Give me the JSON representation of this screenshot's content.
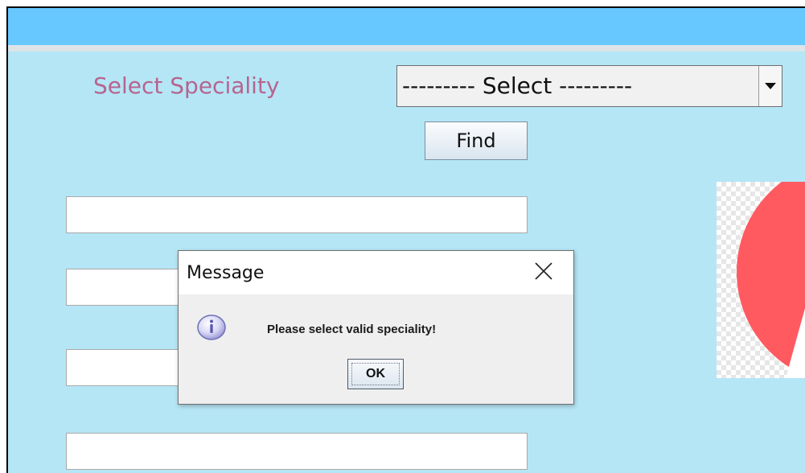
{
  "form": {
    "speciality_label": "Select Speciality",
    "speciality_select_value": "--------- Select ---------",
    "find_label": "Find"
  },
  "dialog": {
    "title": "Message",
    "message": "Please select valid speciality!",
    "ok_label": "OK"
  },
  "icons": {
    "dialog_icon": "information-icon",
    "close": "close-icon",
    "dropdown": "chevron-down-icon"
  },
  "colors": {
    "window_bg": "#b5e6f5",
    "title_bar": "#66c8fe",
    "label_text": "#b6648f",
    "image_shape": "#ff5a60"
  }
}
